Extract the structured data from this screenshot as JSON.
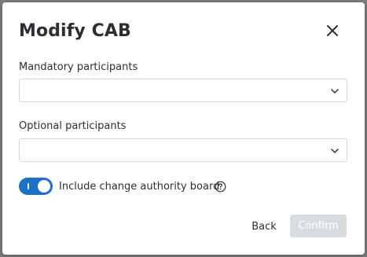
{
  "dialog": {
    "title": "Modify CAB",
    "close_icon": "close-icon"
  },
  "fields": {
    "mandatory": {
      "label": "Mandatory participants",
      "value": "",
      "icon": "chevron-down-icon"
    },
    "optional": {
      "label": "Optional participants",
      "value": "",
      "icon": "chevron-down-icon"
    }
  },
  "toggle": {
    "label": "Include change authority board",
    "on": true,
    "help_icon": "question-circle-icon"
  },
  "actions": {
    "back_label": "Back",
    "confirm_label": "Confirm",
    "confirm_disabled": true
  },
  "colors": {
    "accent": "#1b72c8",
    "text": "#2b2f33",
    "border": "#d4d8dc",
    "disabled_button": "#d9dcdf",
    "backdrop": "#8a8a8a"
  }
}
